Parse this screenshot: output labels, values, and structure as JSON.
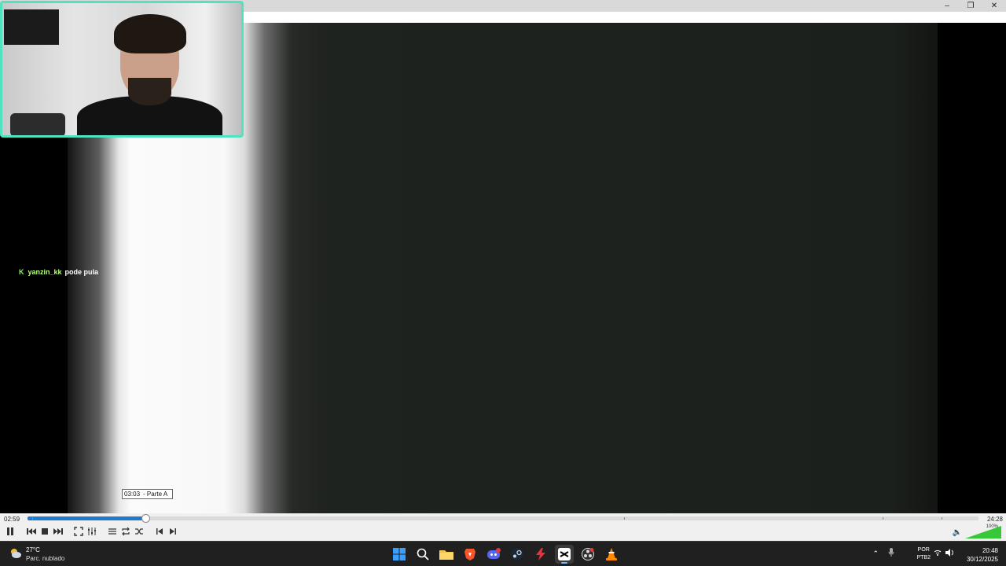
{
  "window": {
    "controls": {
      "minimize": "–",
      "maximize": "❐",
      "close": "✕"
    }
  },
  "overlay": {
    "chat": {
      "badge": "K",
      "username": "yanzin_kk",
      "message": "pode pula"
    },
    "tooltip": {
      "time": "03:03",
      "chapter": "- Parte A"
    }
  },
  "player": {
    "elapsed": "02:59",
    "total": "24:28",
    "progress": 0.124,
    "hover_position": 0.124,
    "volume_label": "100%",
    "volume": 1.0,
    "colors": {
      "accent": "#1f78d1",
      "volume": "#37c837",
      "webcam_border": "#4fe3c0"
    }
  },
  "taskbar": {
    "weather": {
      "temperature": "27°C",
      "condition": "Parc. nublado"
    },
    "apps": [
      "windows-start",
      "search",
      "file-explorer",
      "brave-browser",
      "discord",
      "steam",
      "red-app",
      "capcut",
      "obs",
      "vlc"
    ],
    "tray": {
      "lang_line1": "POR",
      "lang_line2": "PTB2",
      "time": "20:48",
      "date": "30/12/2025"
    }
  }
}
